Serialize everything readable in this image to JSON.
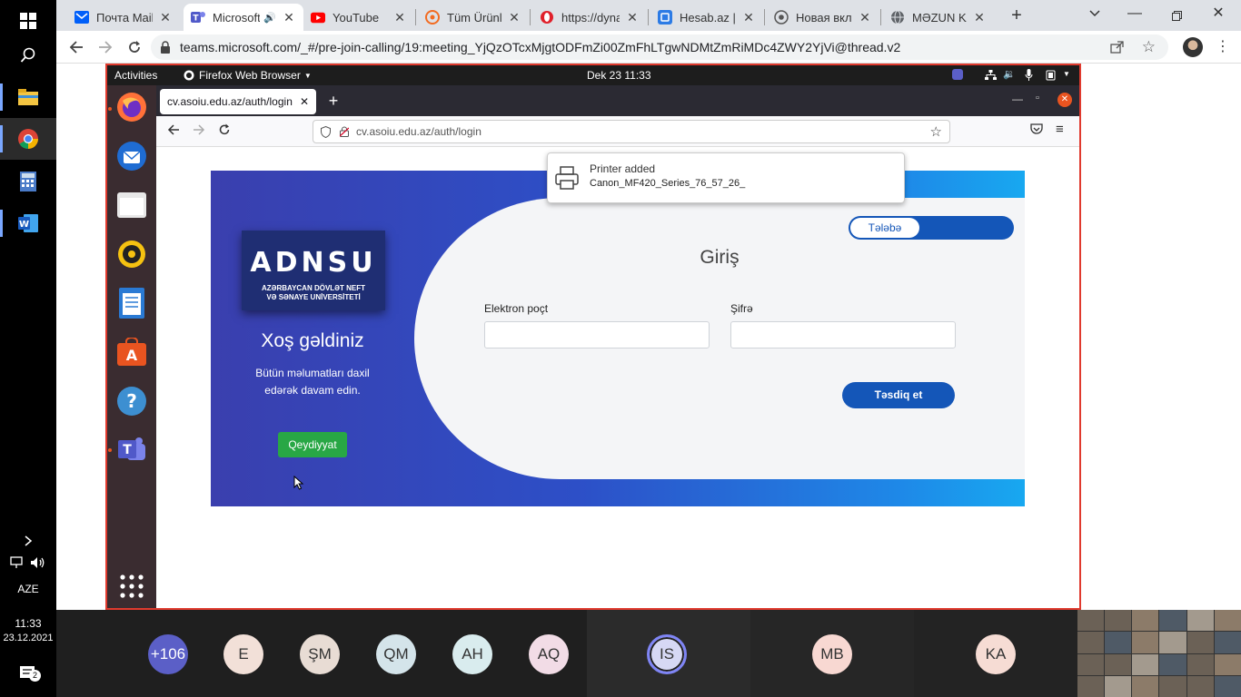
{
  "taskbar": {
    "time": "11:33",
    "date": "23.12.2021",
    "language": "AZE",
    "notification_count": "2"
  },
  "chrome": {
    "tabs": [
      {
        "title": "Почта Mail.ru",
        "icon": "mail-icon"
      },
      {
        "title": "Microsoft Teams",
        "icon": "teams-icon"
      },
      {
        "title": "YouTube",
        "icon": "youtube-icon"
      },
      {
        "title": "Tüm Ürünler",
        "icon": "store-icon"
      },
      {
        "title": "https://dynamic",
        "icon": "opera-icon"
      },
      {
        "title": "Hesab.az | A",
        "icon": "hesab-icon"
      },
      {
        "title": "Новая вкладка",
        "icon": "chrome-icon"
      },
      {
        "title": "MƏZUN KAB",
        "icon": "globe-icon"
      }
    ],
    "url": "teams.microsoft.com/_#/pre-join-calling/19:meeting_YjQzOTcxMjgtODFmZi00ZmFhLTgwNDMtZmRiMDc4ZWY2YjVi@thread.v2"
  },
  "ubuntu": {
    "activities": "Activities",
    "app_name": "Firefox Web Browser",
    "clock": "Dek 23  11:33"
  },
  "firefox": {
    "tab_title": "cv.asoiu.edu.az/auth/login",
    "url": "cv.asoiu.edu.az/auth/login"
  },
  "notification": {
    "title": "Printer added",
    "body": "Canon_MF420_Series_76_57_26_"
  },
  "login": {
    "logo_text": "ADNSU",
    "logo_sub1": "AZƏRBAYCAN DÖVLƏT NEFT",
    "logo_sub2": "VƏ SƏNAYE UNİVERSİTETİ",
    "welcome": "Xoş gəldiniz",
    "subtitle_line1": "Bütün məlumatları daxil",
    "subtitle_line2": "edərək davam edin.",
    "register": "Qeydiyyat",
    "toggle": "Tələbə",
    "title": "Giriş",
    "email_label": "Elektron poçt",
    "password_label": "Şifrə",
    "submit": "Təsdiq et"
  },
  "teams": {
    "participants": [
      {
        "initials": "+106",
        "color": "#5b5fc7"
      },
      {
        "initials": "E",
        "color": "#f2e0d8"
      },
      {
        "initials": "ŞM",
        "color": "#e8dcd4"
      },
      {
        "initials": "QM",
        "color": "#d4e4ea"
      },
      {
        "initials": "AH",
        "color": "#d9ecee"
      },
      {
        "initials": "AQ",
        "color": "#f2dce6"
      },
      {
        "initials": "IS",
        "color": "#d6d8f4"
      },
      {
        "initials": "MB",
        "color": "#f8d8d2"
      },
      {
        "initials": "KA",
        "color": "#f6dcd4"
      }
    ]
  }
}
